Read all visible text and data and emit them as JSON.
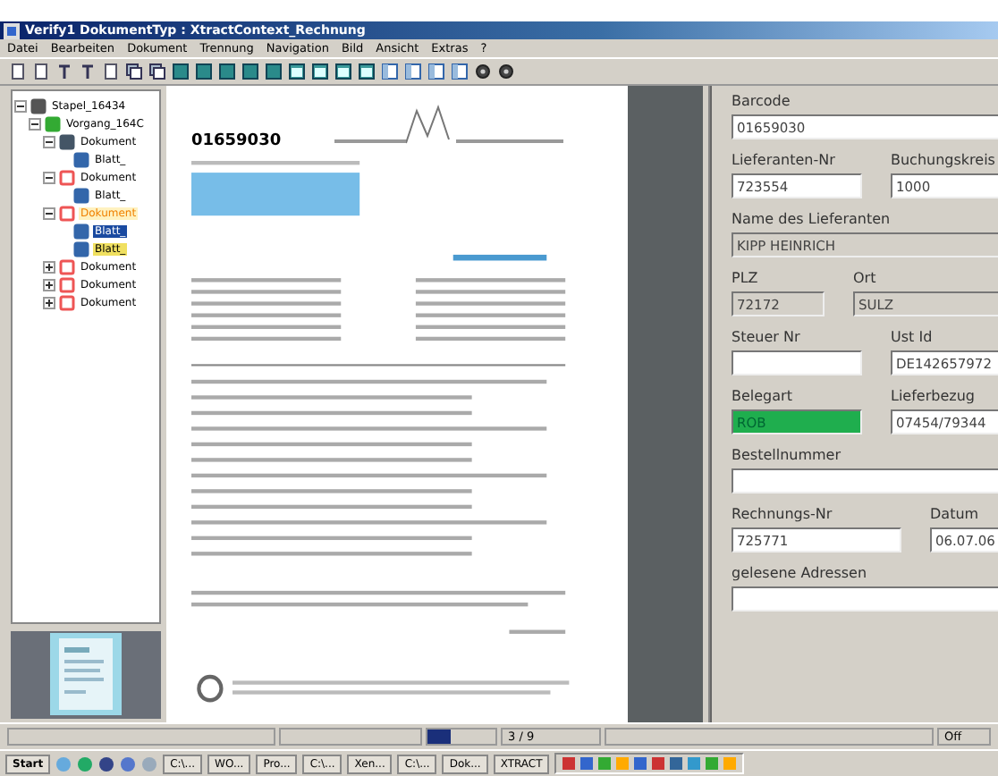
{
  "window": {
    "title": "Verify1 DokumentTyp : XtractContext_Rechnung"
  },
  "menu": [
    "Datei",
    "Bearbeiten",
    "Dokument",
    "Trennung",
    "Navigation",
    "Bild",
    "Ansicht",
    "Extras",
    "?"
  ],
  "tree": [
    {
      "label": "Stapel_16434",
      "kind": "batch",
      "selected": false,
      "expanded": true,
      "children": [
        {
          "label": "Vorgang_164C",
          "kind": "case",
          "selected": false,
          "expanded": true,
          "children": [
            {
              "label": "Dokument",
              "kind": "document",
              "verified": true,
              "selected": false,
              "expanded": true,
              "children": [
                {
                  "label": "Blatt_",
                  "kind": "sheet",
                  "selected": false,
                  "highlighted": false
                }
              ]
            },
            {
              "label": "Dokument",
              "kind": "document",
              "verified": false,
              "selected": false,
              "expanded": true,
              "children": [
                {
                  "label": "Blatt_",
                  "kind": "sheet",
                  "selected": false,
                  "highlighted": false
                }
              ]
            },
            {
              "label": "Dokument",
              "kind": "document",
              "verified": false,
              "selected": true,
              "expanded": true,
              "children": [
                {
                  "label": "Blatt_",
                  "kind": "sheet",
                  "selected": true,
                  "highlighted": false
                },
                {
                  "label": "Blatt_",
                  "kind": "sheet",
                  "selected": false,
                  "highlighted": true
                }
              ]
            },
            {
              "label": "Dokument",
              "kind": "document",
              "verified": false,
              "selected": false,
              "expanded": false
            },
            {
              "label": "Dokument",
              "kind": "document",
              "verified": false,
              "selected": false,
              "expanded": false
            },
            {
              "label": "Dokument",
              "kind": "document",
              "verified": false,
              "selected": false,
              "expanded": false
            }
          ]
        }
      ]
    }
  ],
  "document": {
    "barcode": "01659030"
  },
  "form": [
    [
      {
        "label": "Barcode",
        "value": "01659030",
        "readonly": false,
        "highlighted": false
      }
    ],
    [
      {
        "label": "Lieferanten-Nr",
        "value": "723554",
        "readonly": false,
        "highlighted": false
      },
      {
        "label": "Buchungskreis",
        "value": "1000",
        "readonly": false,
        "highlighted": false
      }
    ],
    [
      {
        "label": "Name des Lieferanten",
        "value": "KIPP HEINRICH",
        "readonly": true,
        "highlighted": false
      }
    ],
    [
      {
        "label": "PLZ",
        "value": "72172",
        "readonly": true,
        "highlighted": false
      },
      {
        "label": "Ort",
        "value": "SULZ",
        "readonly": true,
        "highlighted": false
      }
    ],
    [
      {
        "label": "Steuer Nr",
        "readonly": false,
        "highlighted": false
      },
      {
        "label": "Ust Id",
        "value": "DE142657972",
        "readonly": false,
        "highlighted": false
      }
    ],
    [
      {
        "label": "Belegart",
        "value": "ROB",
        "readonly": false,
        "highlighted": true
      },
      {
        "label": "Lieferbezug",
        "value": "07454/79344",
        "readonly": false,
        "highlighted": false
      }
    ],
    [
      {
        "label": "Bestellnummer",
        "readonly": false,
        "highlighted": false
      }
    ],
    [
      {
        "label": "Rechnungs-Nr",
        "value": "725771",
        "readonly": false,
        "highlighted": false
      },
      {
        "label": "Datum",
        "value": "06.07.06",
        "readonly": false,
        "highlighted": false
      }
    ],
    [
      {
        "label": "gelesene Adressen",
        "readonly": false,
        "highlighted": false
      }
    ]
  ],
  "status_bar": {
    "progress": {
      "level": 0.33
    },
    "page": "3 / 9",
    "mode": "Off"
  },
  "taskbar": [
    "Start",
    "C:\\...",
    "WO...",
    "Pro...",
    "C:\\...",
    "Xen...",
    "C:\\...",
    "Dok...",
    "XTRACT"
  ]
}
